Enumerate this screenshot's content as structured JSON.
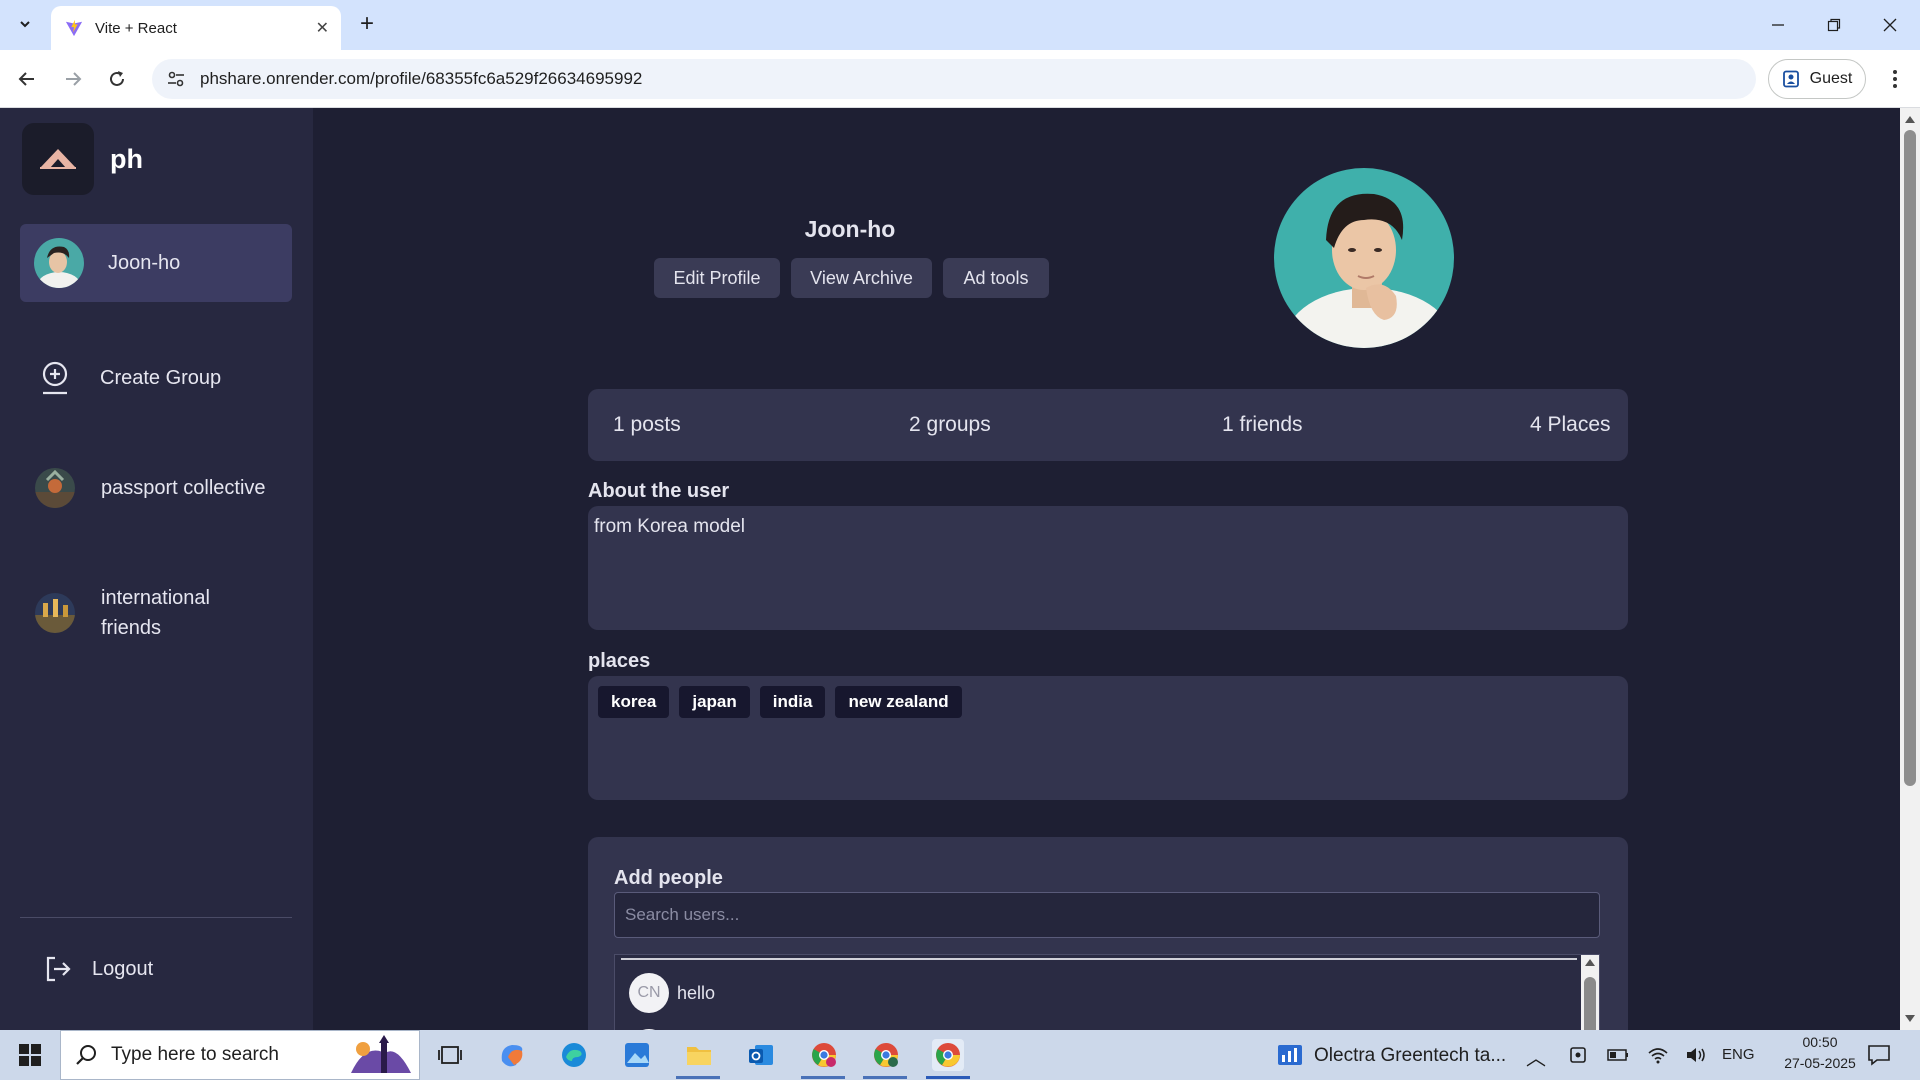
{
  "browser": {
    "tab_title": "Vite + React",
    "url": "phshare.onrender.com/profile/68355fc6a529f26634695992",
    "profile_label": "Guest"
  },
  "sidebar": {
    "brand": "ph",
    "user_name": "Joon-ho",
    "create_group": "Create Group",
    "groups": [
      "passport collective",
      "international friends"
    ],
    "logout": "Logout"
  },
  "profile": {
    "name": "Joon-ho",
    "buttons": {
      "edit": "Edit Profile",
      "archive": "View Archive",
      "ad_tools": "Ad tools"
    },
    "stats": {
      "posts": "1 posts",
      "groups": "2 groups",
      "friends": "1 friends",
      "places": "4 Places"
    },
    "about_label": "About the user",
    "about_text": "from Korea model",
    "places_label": "places",
    "places": [
      "korea",
      "japan",
      "india",
      "new zealand"
    ]
  },
  "add_people": {
    "label": "Add people",
    "placeholder": "Search users...",
    "results": [
      {
        "initials": "CN",
        "name": "hello"
      }
    ]
  },
  "taskbar": {
    "search_placeholder": "Type here to search",
    "news": "Olectra Greentech ta...",
    "lang": "ENG",
    "time": "00:50",
    "date": "27-05-2025"
  },
  "colors": {
    "page_bg": "#1e1f33",
    "sidebar_bg": "#272840",
    "panel_bg": "#33344e",
    "active_item": "#3c3c62",
    "tag_bg": "#17172e"
  }
}
